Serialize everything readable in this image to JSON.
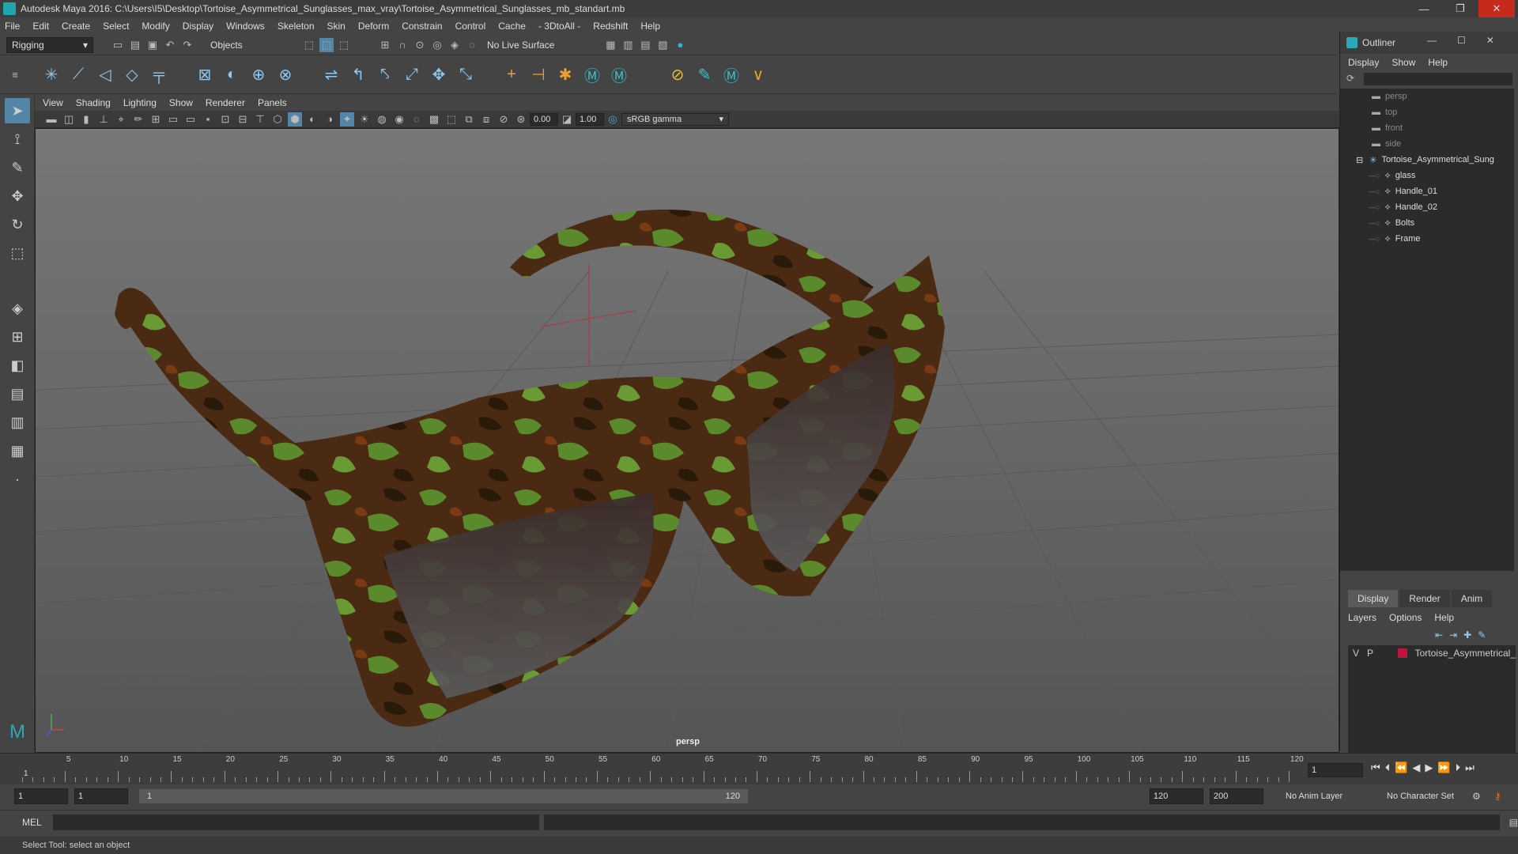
{
  "window": {
    "title": "Autodesk Maya 2016: C:\\Users\\I5\\Desktop\\Tortoise_Asymmetrical_Sunglasses_max_vray\\Tortoise_Asymmetrical_Sunglasses_mb_standart.mb",
    "minimize": "—",
    "restore": "❐",
    "close": "✕"
  },
  "menubar": [
    "File",
    "Edit",
    "Create",
    "Select",
    "Modify",
    "Display",
    "Windows",
    "Skeleton",
    "Skin",
    "Deform",
    "Constrain",
    "Control",
    "Cache",
    "- 3DtoAll -",
    "Redshift",
    "Help"
  ],
  "statusline": {
    "mode": "Rigging",
    "selection_mode": "Objects",
    "live_surface": "No Live Surface"
  },
  "panel": {
    "menus": [
      "View",
      "Shading",
      "Lighting",
      "Show",
      "Renderer",
      "Panels"
    ],
    "exposure": "0.00",
    "gamma": "1.00",
    "color_space": "sRGB gamma",
    "camera_label": "persp"
  },
  "outliner": {
    "title": "Outliner",
    "menus": [
      "Display",
      "Show",
      "Help"
    ],
    "cameras": [
      "persp",
      "top",
      "front",
      "side"
    ],
    "root": "Tortoise_Asymmetrical_Sung",
    "children": [
      "glass",
      "Handle_01",
      "Handle_02",
      "Bolts",
      "Frame"
    ]
  },
  "layers": {
    "tabs": [
      "Display",
      "Render",
      "Anim"
    ],
    "menus": [
      "Layers",
      "Options",
      "Help"
    ],
    "row": {
      "v": "V",
      "p": "P",
      "name": "Tortoise_Asymmetrical_",
      "color": "#c0143c"
    }
  },
  "timeline": {
    "ticks": [
      "5",
      "10",
      "15",
      "20",
      "25",
      "30",
      "35",
      "40",
      "45",
      "50",
      "55",
      "60",
      "65",
      "70",
      "75",
      "80",
      "85",
      "90",
      "95",
      "100",
      "105",
      "110",
      "115",
      "120"
    ],
    "start_tick": "1",
    "current_frame": "1"
  },
  "range": {
    "start": "1",
    "start2": "1",
    "slider_start": "1",
    "slider_end": "120",
    "end": "120",
    "end2": "200",
    "anim_layer": "No Anim Layer",
    "char_set": "No Character Set"
  },
  "cmd": {
    "label": "MEL"
  },
  "help": {
    "text": "Select Tool: select an object"
  },
  "colors": {
    "camo_green": "#5a8a2c",
    "camo_brown": "#4a2a12",
    "lens": "#4a3a38"
  }
}
